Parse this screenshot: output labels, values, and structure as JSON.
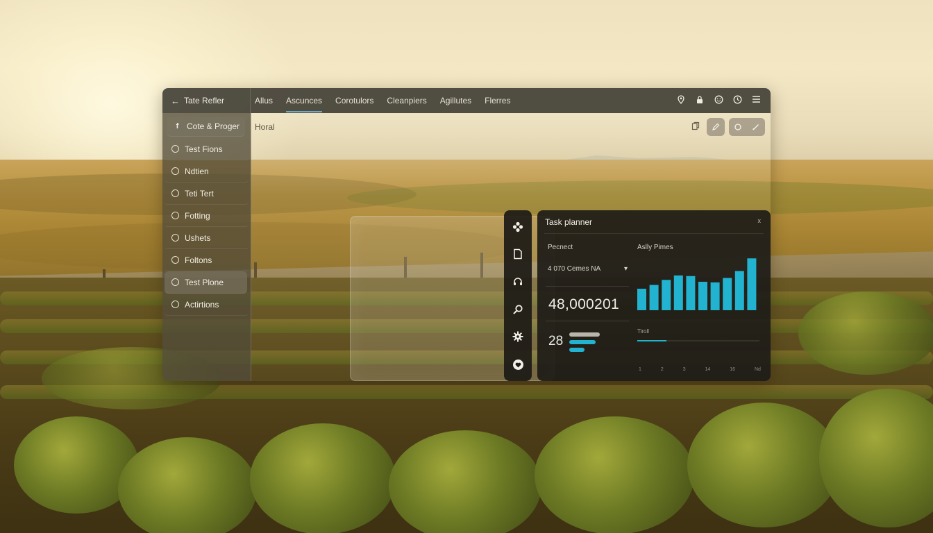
{
  "window": {
    "brand": {
      "back_icon": "arrow-left-icon",
      "title": "Tate Refler"
    },
    "nav_tabs": [
      {
        "label": "Allus",
        "active": false
      },
      {
        "label": "Ascunces",
        "active": true
      },
      {
        "label": "Corotulors",
        "active": false
      },
      {
        "label": "Cleanpiers",
        "active": false
      },
      {
        "label": "Agillutes",
        "active": false
      },
      {
        "label": "Flerres",
        "active": false
      }
    ],
    "top_icons": [
      "location-pin-icon",
      "lock-icon",
      "smiley-icon",
      "clock-icon",
      "menu-icon"
    ]
  },
  "sidebar": {
    "items": [
      {
        "label": "Cote & Proger",
        "icon": "f-icon",
        "state": "active"
      },
      {
        "label": "Test Fions",
        "icon": "circle-icon",
        "state": ""
      },
      {
        "label": "Ndtien",
        "icon": "circle-icon",
        "state": ""
      },
      {
        "label": "Teti Tert",
        "icon": "circle-icon",
        "state": ""
      },
      {
        "label": "Fotting",
        "icon": "circle-icon",
        "state": ""
      },
      {
        "label": "Ushets",
        "icon": "circle-icon",
        "state": ""
      },
      {
        "label": "Foltons",
        "icon": "circle-icon",
        "state": ""
      },
      {
        "label": "Test Plone",
        "icon": "circle-icon",
        "state": "highlight"
      },
      {
        "label": "Actirtions",
        "icon": "circle-icon",
        "state": ""
      }
    ]
  },
  "content": {
    "title": "Horal",
    "tools": [
      "copy-icon",
      "edit-icon",
      "refresh-icon",
      "pencil-icon"
    ]
  },
  "iconbar": {
    "icons": [
      "flower-icon",
      "document-icon",
      "headset-icon",
      "search-icon",
      "gear-icon",
      "heart-icon"
    ]
  },
  "panel": {
    "title": "Task planner",
    "close": "x",
    "project_label": "Pecnect",
    "select_value": "4 070 Cemes NA",
    "select_chevron": "▾",
    "big_number": "48,000201",
    "small_number": "28",
    "chart_label": "Aslly Pimes",
    "trend_label": "Tiroll",
    "x_ticks": [
      "1",
      "2",
      "3",
      "14",
      "16",
      "Nd"
    ]
  },
  "colors": {
    "accent": "#21b3cf",
    "panel_bg": "#1e1c18",
    "sidebar_bg": "#524c3a"
  },
  "chart_data": {
    "type": "bar",
    "categories": [
      "1",
      "2",
      "3",
      "4",
      "5",
      "6",
      "7",
      "8",
      "9",
      "10"
    ],
    "values": [
      3.4,
      4.0,
      4.8,
      5.5,
      5.4,
      4.5,
      4.4,
      5.1,
      6.2,
      8.2
    ],
    "ylim": [
      0,
      9
    ],
    "grid": false,
    "color": "#21b3cf"
  }
}
